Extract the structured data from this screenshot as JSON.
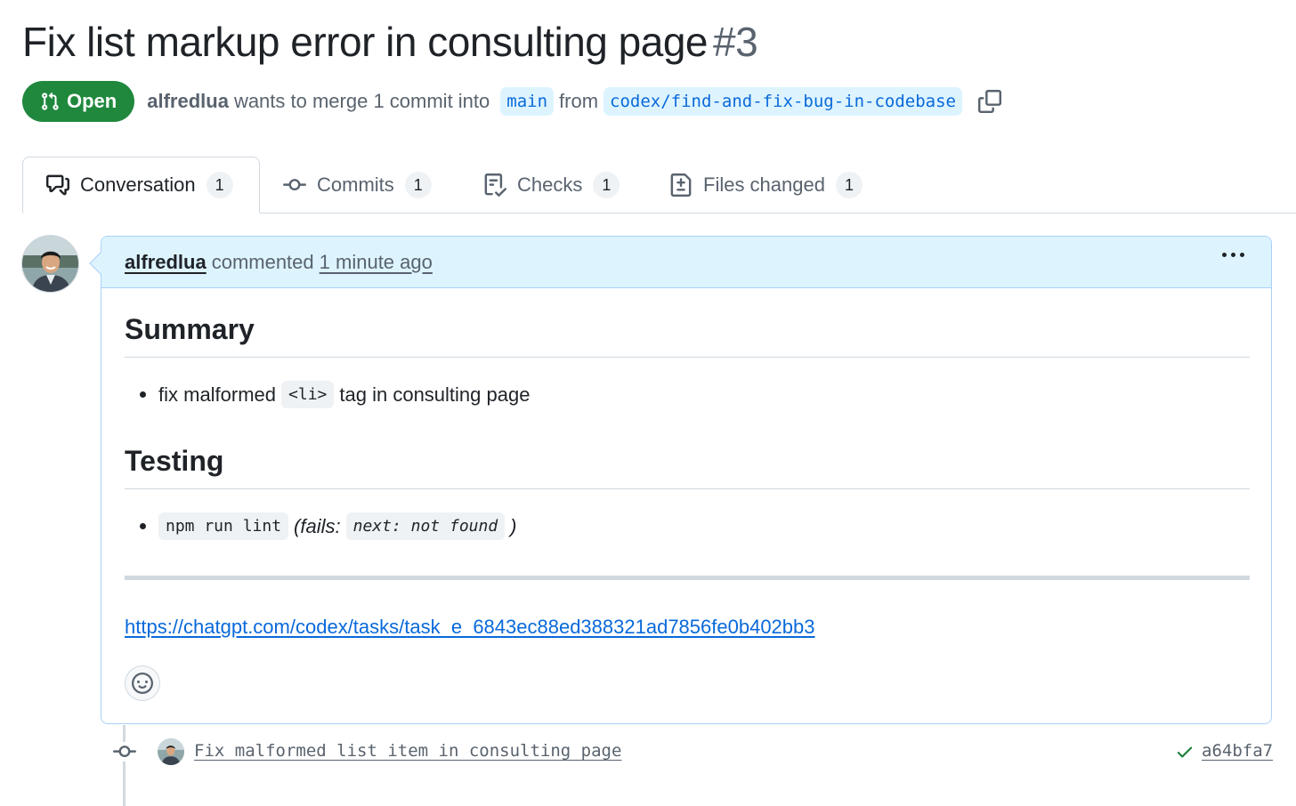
{
  "pr": {
    "title": "Fix list markup error in consulting page",
    "number": "#3",
    "state": "Open",
    "author": "alfredlua",
    "merge_text": "wants to merge 1 commit into",
    "base_branch": "main",
    "from_text": "from",
    "head_branch": "codex/find-and-fix-bug-in-codebase"
  },
  "tabs": [
    {
      "label": "Conversation",
      "count": "1",
      "icon": "comment-discussion-icon"
    },
    {
      "label": "Commits",
      "count": "1",
      "icon": "git-commit-icon"
    },
    {
      "label": "Checks",
      "count": "1",
      "icon": "checklist-icon"
    },
    {
      "label": "Files changed",
      "count": "1",
      "icon": "file-diff-icon"
    }
  ],
  "comment": {
    "author": "alfredlua",
    "verb": "commented",
    "time": "1 minute ago",
    "summary_heading": "Summary",
    "summary_item": {
      "before": "fix malformed",
      "code": "<li>",
      "after": "tag in consulting page"
    },
    "testing_heading": "Testing",
    "testing_item": {
      "code": "npm run lint",
      "before_note": "(fails:",
      "note_code": "next: not found",
      "after_note": ")"
    },
    "link": "https://chatgpt.com/codex/tasks/task_e_6843ec88ed388321ad7856fe0b402bb3"
  },
  "commit": {
    "message": "Fix malformed list item in consulting page",
    "sha": "a64bfa7",
    "status": "success"
  },
  "colors": {
    "open_green": "#1f883d",
    "link_blue": "#0969da",
    "header_blue": "#ddf4ff",
    "border_blue": "#a9d1f7"
  }
}
